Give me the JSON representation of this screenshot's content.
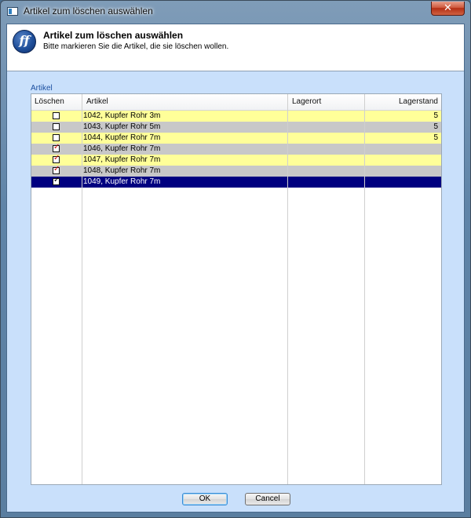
{
  "window": {
    "title": "Artikel zum löschen auswählen",
    "close_glyph": "✕"
  },
  "header": {
    "logo_text": "ff",
    "title": "Artikel zum löschen auswählen",
    "subtitle": "Bitte markieren Sie die Artikel, die sie löschen wollen."
  },
  "group": {
    "label": "Artikel"
  },
  "grid": {
    "columns": [
      "Löschen",
      "Artikel",
      "Lagerort",
      "Lagerstand"
    ],
    "rows": [
      {
        "checked": false,
        "checkmark_color": "",
        "artikel": "1042, Kupfer Rohr 3m",
        "lagerort": "",
        "lagerstand": "5",
        "bg": "#ffff99",
        "fg": "#000000"
      },
      {
        "checked": false,
        "checkmark_color": "",
        "artikel": "1043, Kupfer Rohr 5m",
        "lagerort": "",
        "lagerstand": "5",
        "bg": "#c8c8c8",
        "fg": "#000000"
      },
      {
        "checked": false,
        "checkmark_color": "",
        "artikel": "1044, Kupfer Rohr 7m",
        "lagerort": "",
        "lagerstand": "5",
        "bg": "#ffff99",
        "fg": "#000000"
      },
      {
        "checked": true,
        "checkmark_color": "#d01010",
        "artikel": "1046, Kupfer Rohr 7m",
        "lagerort": "",
        "lagerstand": "",
        "bg": "#c8c8c8",
        "fg": "#000000"
      },
      {
        "checked": true,
        "checkmark_color": "#d01010",
        "artikel": "1047, Kupfer Rohr 7m",
        "lagerort": "",
        "lagerstand": "",
        "bg": "#ffff99",
        "fg": "#000000"
      },
      {
        "checked": true,
        "checkmark_color": "#d01010",
        "artikel": "1048, Kupfer Rohr 7m",
        "lagerort": "",
        "lagerstand": "",
        "bg": "#c8c8c8",
        "fg": "#000000"
      },
      {
        "checked": true,
        "checkmark_color": "#000000",
        "artikel": "1049, Kupfer Rohr 7m",
        "lagerort": "",
        "lagerstand": "",
        "bg": "#000080",
        "fg": "#ffffff",
        "selected": true
      }
    ]
  },
  "buttons": {
    "ok": "OK",
    "cancel": "Cancel"
  },
  "colors": {
    "client_bg": "#c9e0fb",
    "group_label": "#1c4fa0",
    "selection": "#000080"
  }
}
